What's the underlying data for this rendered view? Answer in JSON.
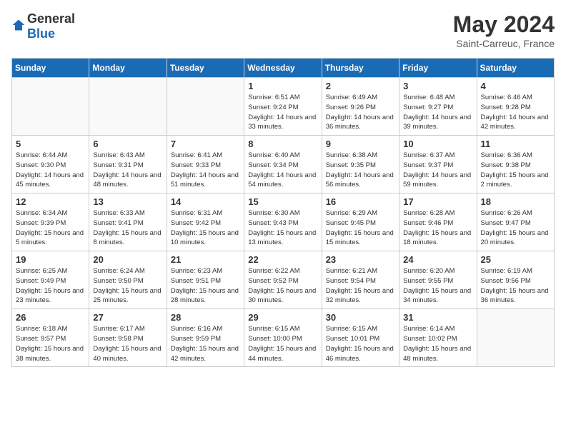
{
  "header": {
    "logo_general": "General",
    "logo_blue": "Blue",
    "title": "May 2024",
    "subtitle": "Saint-Carreuc, France"
  },
  "weekdays": [
    "Sunday",
    "Monday",
    "Tuesday",
    "Wednesday",
    "Thursday",
    "Friday",
    "Saturday"
  ],
  "weeks": [
    [
      {
        "day": "",
        "sunrise": "",
        "sunset": "",
        "daylight": ""
      },
      {
        "day": "",
        "sunrise": "",
        "sunset": "",
        "daylight": ""
      },
      {
        "day": "",
        "sunrise": "",
        "sunset": "",
        "daylight": ""
      },
      {
        "day": "1",
        "sunrise": "Sunrise: 6:51 AM",
        "sunset": "Sunset: 9:24 PM",
        "daylight": "Daylight: 14 hours and 33 minutes."
      },
      {
        "day": "2",
        "sunrise": "Sunrise: 6:49 AM",
        "sunset": "Sunset: 9:26 PM",
        "daylight": "Daylight: 14 hours and 36 minutes."
      },
      {
        "day": "3",
        "sunrise": "Sunrise: 6:48 AM",
        "sunset": "Sunset: 9:27 PM",
        "daylight": "Daylight: 14 hours and 39 minutes."
      },
      {
        "day": "4",
        "sunrise": "Sunrise: 6:46 AM",
        "sunset": "Sunset: 9:28 PM",
        "daylight": "Daylight: 14 hours and 42 minutes."
      }
    ],
    [
      {
        "day": "5",
        "sunrise": "Sunrise: 6:44 AM",
        "sunset": "Sunset: 9:30 PM",
        "daylight": "Daylight: 14 hours and 45 minutes."
      },
      {
        "day": "6",
        "sunrise": "Sunrise: 6:43 AM",
        "sunset": "Sunset: 9:31 PM",
        "daylight": "Daylight: 14 hours and 48 minutes."
      },
      {
        "day": "7",
        "sunrise": "Sunrise: 6:41 AM",
        "sunset": "Sunset: 9:33 PM",
        "daylight": "Daylight: 14 hours and 51 minutes."
      },
      {
        "day": "8",
        "sunrise": "Sunrise: 6:40 AM",
        "sunset": "Sunset: 9:34 PM",
        "daylight": "Daylight: 14 hours and 54 minutes."
      },
      {
        "day": "9",
        "sunrise": "Sunrise: 6:38 AM",
        "sunset": "Sunset: 9:35 PM",
        "daylight": "Daylight: 14 hours and 56 minutes."
      },
      {
        "day": "10",
        "sunrise": "Sunrise: 6:37 AM",
        "sunset": "Sunset: 9:37 PM",
        "daylight": "Daylight: 14 hours and 59 minutes."
      },
      {
        "day": "11",
        "sunrise": "Sunrise: 6:36 AM",
        "sunset": "Sunset: 9:38 PM",
        "daylight": "Daylight: 15 hours and 2 minutes."
      }
    ],
    [
      {
        "day": "12",
        "sunrise": "Sunrise: 6:34 AM",
        "sunset": "Sunset: 9:39 PM",
        "daylight": "Daylight: 15 hours and 5 minutes."
      },
      {
        "day": "13",
        "sunrise": "Sunrise: 6:33 AM",
        "sunset": "Sunset: 9:41 PM",
        "daylight": "Daylight: 15 hours and 8 minutes."
      },
      {
        "day": "14",
        "sunrise": "Sunrise: 6:31 AM",
        "sunset": "Sunset: 9:42 PM",
        "daylight": "Daylight: 15 hours and 10 minutes."
      },
      {
        "day": "15",
        "sunrise": "Sunrise: 6:30 AM",
        "sunset": "Sunset: 9:43 PM",
        "daylight": "Daylight: 15 hours and 13 minutes."
      },
      {
        "day": "16",
        "sunrise": "Sunrise: 6:29 AM",
        "sunset": "Sunset: 9:45 PM",
        "daylight": "Daylight: 15 hours and 15 minutes."
      },
      {
        "day": "17",
        "sunrise": "Sunrise: 6:28 AM",
        "sunset": "Sunset: 9:46 PM",
        "daylight": "Daylight: 15 hours and 18 minutes."
      },
      {
        "day": "18",
        "sunrise": "Sunrise: 6:26 AM",
        "sunset": "Sunset: 9:47 PM",
        "daylight": "Daylight: 15 hours and 20 minutes."
      }
    ],
    [
      {
        "day": "19",
        "sunrise": "Sunrise: 6:25 AM",
        "sunset": "Sunset: 9:49 PM",
        "daylight": "Daylight: 15 hours and 23 minutes."
      },
      {
        "day": "20",
        "sunrise": "Sunrise: 6:24 AM",
        "sunset": "Sunset: 9:50 PM",
        "daylight": "Daylight: 15 hours and 25 minutes."
      },
      {
        "day": "21",
        "sunrise": "Sunrise: 6:23 AM",
        "sunset": "Sunset: 9:51 PM",
        "daylight": "Daylight: 15 hours and 28 minutes."
      },
      {
        "day": "22",
        "sunrise": "Sunrise: 6:22 AM",
        "sunset": "Sunset: 9:52 PM",
        "daylight": "Daylight: 15 hours and 30 minutes."
      },
      {
        "day": "23",
        "sunrise": "Sunrise: 6:21 AM",
        "sunset": "Sunset: 9:54 PM",
        "daylight": "Daylight: 15 hours and 32 minutes."
      },
      {
        "day": "24",
        "sunrise": "Sunrise: 6:20 AM",
        "sunset": "Sunset: 9:55 PM",
        "daylight": "Daylight: 15 hours and 34 minutes."
      },
      {
        "day": "25",
        "sunrise": "Sunrise: 6:19 AM",
        "sunset": "Sunset: 9:56 PM",
        "daylight": "Daylight: 15 hours and 36 minutes."
      }
    ],
    [
      {
        "day": "26",
        "sunrise": "Sunrise: 6:18 AM",
        "sunset": "Sunset: 9:57 PM",
        "daylight": "Daylight: 15 hours and 38 minutes."
      },
      {
        "day": "27",
        "sunrise": "Sunrise: 6:17 AM",
        "sunset": "Sunset: 9:58 PM",
        "daylight": "Daylight: 15 hours and 40 minutes."
      },
      {
        "day": "28",
        "sunrise": "Sunrise: 6:16 AM",
        "sunset": "Sunset: 9:59 PM",
        "daylight": "Daylight: 15 hours and 42 minutes."
      },
      {
        "day": "29",
        "sunrise": "Sunrise: 6:15 AM",
        "sunset": "Sunset: 10:00 PM",
        "daylight": "Daylight: 15 hours and 44 minutes."
      },
      {
        "day": "30",
        "sunrise": "Sunrise: 6:15 AM",
        "sunset": "Sunset: 10:01 PM",
        "daylight": "Daylight: 15 hours and 46 minutes."
      },
      {
        "day": "31",
        "sunrise": "Sunrise: 6:14 AM",
        "sunset": "Sunset: 10:02 PM",
        "daylight": "Daylight: 15 hours and 48 minutes."
      },
      {
        "day": "",
        "sunrise": "",
        "sunset": "",
        "daylight": ""
      }
    ]
  ]
}
